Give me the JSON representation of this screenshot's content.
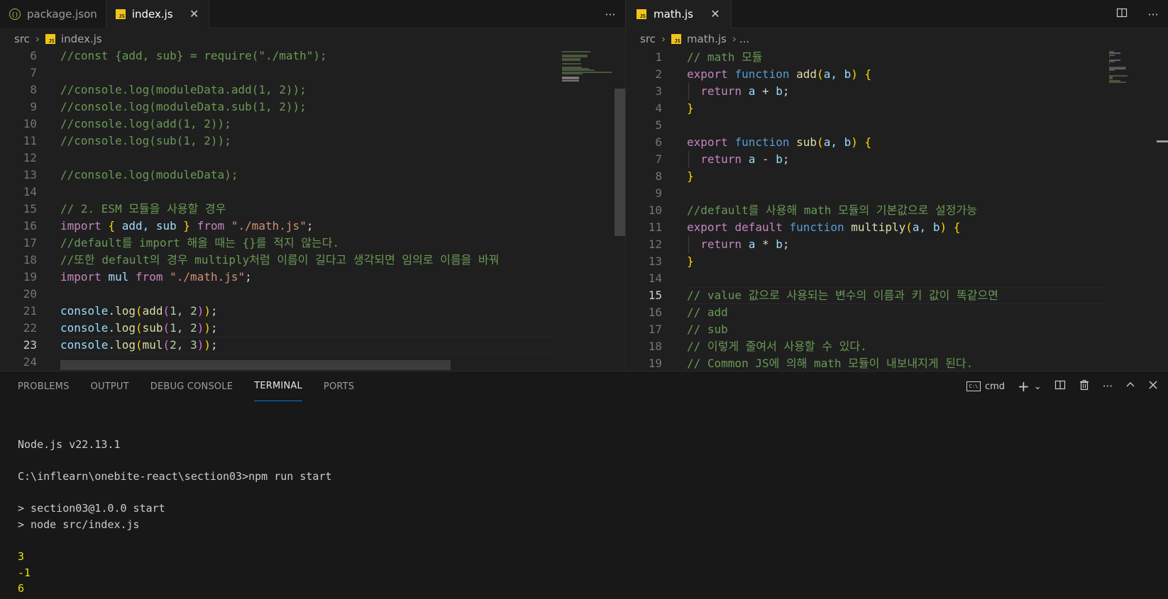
{
  "left_editor": {
    "tabs": [
      {
        "label": "package.json",
        "icon": "json-file-icon",
        "active": false
      },
      {
        "label": "index.js",
        "icon": "js-file-icon",
        "active": true,
        "close": "✕"
      }
    ],
    "more_label": "···",
    "breadcrumb": {
      "folder": "src",
      "file": "index.js"
    },
    "current_line": "23",
    "lines": [
      {
        "num": "6",
        "text": "//const {add, sub} = require(\"./math\");"
      },
      {
        "num": "7",
        "text": ""
      },
      {
        "num": "8",
        "text": "//console.log(moduleData.add(1, 2));"
      },
      {
        "num": "9",
        "text": "//console.log(moduleData.sub(1, 2));"
      },
      {
        "num": "10",
        "text": "//console.log(add(1, 2));"
      },
      {
        "num": "11",
        "text": "//console.log(sub(1, 2));"
      },
      {
        "num": "12",
        "text": ""
      },
      {
        "num": "13",
        "text": "//console.log(moduleData);"
      },
      {
        "num": "14",
        "text": ""
      },
      {
        "num": "15",
        "text": "// 2. ESM 모듈을 사용할 경우"
      },
      {
        "num": "16",
        "text": "import { add, sub } from \"./math.js\";"
      },
      {
        "num": "17",
        "text": "//default를 import 해올 때는 {}를 적지 않는다."
      },
      {
        "num": "18",
        "text": "//또한 default의 경우 multiply처럼 이름이 길다고 생각되면 임의로 이름을 바꿔"
      },
      {
        "num": "19",
        "text": "import mul from \"./math.js\";"
      },
      {
        "num": "20",
        "text": ""
      },
      {
        "num": "21",
        "text": "console.log(add(1, 2));"
      },
      {
        "num": "22",
        "text": "console.log(sub(1, 2));"
      },
      {
        "num": "23",
        "text": "console.log(mul(2, 3));"
      },
      {
        "num": "24",
        "text": ""
      }
    ],
    "code_tokens": {
      "l16": {
        "import": "import",
        "ob": "{",
        "names": " add, sub ",
        "cb": "}",
        "from": "from",
        "path": "\"./math.js\"",
        "semi": ";"
      },
      "l19": {
        "import": "import",
        "name": "mul",
        "from": "from",
        "path": "\"./math.js\"",
        "semi": ";"
      },
      "l21": {
        "obj": "console",
        "dot": ".",
        "fn": "log",
        "p1": "(",
        "inner": "add",
        "p2": "(",
        "args": "1, 2",
        "p3": ")",
        "p4": ")",
        "semi": ";"
      },
      "l22": {
        "obj": "console",
        "dot": ".",
        "fn": "log",
        "p1": "(",
        "inner": "sub",
        "p2": "(",
        "args": "1, 2",
        "p3": ")",
        "p4": ")",
        "semi": ";"
      },
      "l23": {
        "obj": "console",
        "dot": ".",
        "fn": "log",
        "p1": "(",
        "inner": "mul",
        "p2": "(",
        "args": "2, 3",
        "p3": ")",
        "p4": ")",
        "semi": ";"
      }
    }
  },
  "right_editor": {
    "tabs": [
      {
        "label": "math.js",
        "icon": "js-file-icon",
        "active": true,
        "close": "✕"
      }
    ],
    "breadcrumb": {
      "folder": "src",
      "file": "math.js",
      "more": "..."
    },
    "current_line": "15",
    "lines": [
      {
        "num": "1",
        "text": "// math 모듈"
      },
      {
        "num": "2",
        "text": "export function add(a, b) {"
      },
      {
        "num": "3",
        "text": "  return a + b;"
      },
      {
        "num": "4",
        "text": "}"
      },
      {
        "num": "5",
        "text": ""
      },
      {
        "num": "6",
        "text": "export function sub(a, b) {"
      },
      {
        "num": "7",
        "text": "  return a - b;"
      },
      {
        "num": "8",
        "text": "}"
      },
      {
        "num": "9",
        "text": ""
      },
      {
        "num": "10",
        "text": "//default를 사용해 math 모듈의 기본값으로 설정가능"
      },
      {
        "num": "11",
        "text": "export default function multiply(a, b) {"
      },
      {
        "num": "12",
        "text": "  return a * b;"
      },
      {
        "num": "13",
        "text": "}"
      },
      {
        "num": "14",
        "text": ""
      },
      {
        "num": "15",
        "text": "// value 값으로 사용되는 변수의 이름과 키 값이 똑같으면"
      },
      {
        "num": "16",
        "text": "// add"
      },
      {
        "num": "17",
        "text": "// sub"
      },
      {
        "num": "18",
        "text": "// 이렇게 줄여서 사용할 수 있다."
      },
      {
        "num": "19",
        "text": "// Common JS에 의해 math 모듈이 내보내지게 된다."
      }
    ],
    "code_tokens": {
      "fn_lines": [
        {
          "export": "export",
          "def": "",
          "function": "function",
          "name": "add",
          "params": "a, b",
          "ob": "{"
        },
        {
          "export": "export",
          "def": "",
          "function": "function",
          "name": "sub",
          "params": "a, b",
          "ob": "{"
        },
        {
          "export": "export",
          "def": "default",
          "function": "function",
          "name": "multiply",
          "params": "a, b",
          "ob": "{"
        }
      ],
      "returns": [
        {
          "ret": "return",
          "a": "a",
          "op": "+",
          "b": "b"
        },
        {
          "ret": "return",
          "a": "a",
          "op": "-",
          "b": "b"
        },
        {
          "ret": "return",
          "a": "a",
          "op": "*",
          "b": "b"
        }
      ],
      "closer": "}"
    },
    "split_icon": "split-editor-icon"
  },
  "panel": {
    "tabs": [
      {
        "label": "PROBLEMS",
        "active": false
      },
      {
        "label": "OUTPUT",
        "active": false
      },
      {
        "label": "DEBUG CONSOLE",
        "active": false
      },
      {
        "label": "TERMINAL",
        "active": true
      },
      {
        "label": "PORTS",
        "active": false
      }
    ],
    "terminal_profile": "cmd",
    "terminal_icon_text": "C:\\",
    "actions": [
      "+",
      "⌄",
      "split-icon",
      "trash-icon",
      "···",
      "chevron-up-icon",
      "close-icon"
    ],
    "terminal_lines": [
      {
        "text": "Node.js v22.13.1",
        "style": "normal"
      },
      {
        "text": "",
        "style": "normal"
      },
      {
        "text": "C:\\inflearn\\onebite-react\\section03>npm run start",
        "style": "normal"
      },
      {
        "text": "",
        "style": "normal"
      },
      {
        "text": "> section03@1.0.0 start",
        "style": "normal"
      },
      {
        "text": "> node src/index.js",
        "style": "normal"
      },
      {
        "text": "",
        "style": "normal"
      },
      {
        "text": "3",
        "style": "out"
      },
      {
        "text": "-1",
        "style": "out"
      },
      {
        "text": "6",
        "style": "out"
      }
    ]
  },
  "colors": {
    "comment": "#6a9955",
    "keyword": "#c586c0",
    "string": "#ce9178",
    "function": "#dcdcaa",
    "variable": "#9cdcfe",
    "accent": "#0078d4",
    "terminal_output": "#e5e510"
  }
}
